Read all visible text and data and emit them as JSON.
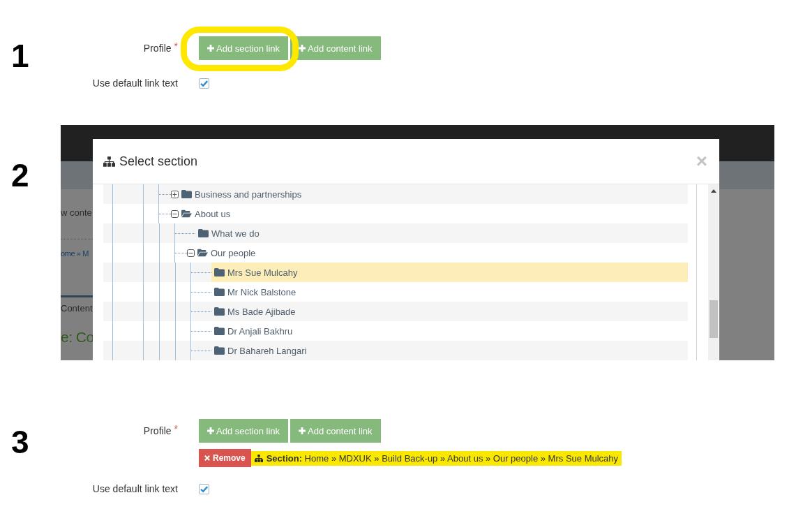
{
  "steps": [
    {
      "number": "1",
      "kind": "form",
      "profile_label": "Profile",
      "required_mark": "*",
      "buttons": [
        {
          "label": "Add section link",
          "highlighted": true
        },
        {
          "label": "Add content link",
          "highlighted": false
        }
      ],
      "default_text": {
        "label": "Use default link text",
        "checked": true
      }
    },
    {
      "number": "2",
      "kind": "dialog",
      "background_texts": [
        {
          "kind": "text",
          "text": "w conte"
        },
        {
          "kind": "link",
          "text": "ome » M"
        },
        {
          "kind": "tab",
          "text": "Content"
        },
        {
          "kind": "heading",
          "text": "e: Co"
        }
      ],
      "dialog": {
        "title": "Select section",
        "close": "×",
        "tree": [
          {
            "label": "Business and partnerships",
            "expanded": false,
            "selected": false
          },
          {
            "label": "About us",
            "expanded": true,
            "selected": false,
            "children": [
              {
                "label": "What we do",
                "selected": false
              },
              {
                "label": "Our people",
                "expanded": true,
                "selected": false,
                "children": [
                  {
                    "label": "Mrs Sue Mulcahy",
                    "selected": true
                  },
                  {
                    "label": "Mr Nick Balstone",
                    "selected": false
                  },
                  {
                    "label": "Ms Bade Ajibade",
                    "selected": false
                  },
                  {
                    "label": "Dr Anjali Bakhru",
                    "selected": false
                  },
                  {
                    "label": "Dr Bahareh Langari",
                    "selected": false
                  }
                ]
              }
            ]
          }
        ]
      }
    },
    {
      "number": "3",
      "kind": "form",
      "profile_label": "Profile",
      "required_mark": "*",
      "buttons": [
        {
          "label": "Add section link",
          "highlighted": false
        },
        {
          "label": "Add content link",
          "highlighted": false
        }
      ],
      "selection": {
        "remove": "Remove",
        "path": "**Section:** Home » MDXUK » Build Back-up » About us » Our people » Mrs Sue Mulcahy",
        "highlighted": true
      },
      "default_text": {
        "label": "Use default link text",
        "checked": true
      }
    }
  ]
}
